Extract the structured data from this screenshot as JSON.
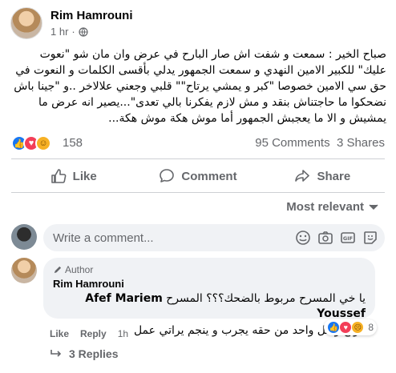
{
  "post": {
    "author": "Rim Hamrouni",
    "time": "1 hr",
    "text": "صباح الخير : سمعت و شفت اش صار البارح في عرض وان مان شو \"نعوت عليك\" للكبير الامين النهدي و سمعت الجمهور يدلي بأقسى الكلمات و النعوت في حق سي الامين خصوصا \"كبر و يمشي يرتاح\"\" قلبي وجعني علالاخر ..و \"جينا باش نضحكوا ما حاجتناش بنقد و مش لازم يفكرنا بالي تعدى\"...يصير انه عرض ما يمشيش و الا ما يعجبش الجمهور أما موش هكة موش هكة..."
  },
  "stats": {
    "reaction_count": "158",
    "comments": "95 Comments",
    "shares": "3 Shares"
  },
  "actions": {
    "like": "Like",
    "comment": "Comment",
    "share": "Share"
  },
  "sort": {
    "label": "Most relevant"
  },
  "composer": {
    "placeholder": "Write a comment..."
  },
  "comment": {
    "badge": "Author",
    "author": "Rim Hamrouni",
    "mention": "Afef Mariem Youssef",
    "text_line1": "يا خي المسرح مربوط بالضحك؟؟؟ المسرح",
    "text_line2": "أنواع و كل واحد من حقه يجرب و ينجم يراتي عمل",
    "reaction_count": "8",
    "like": "Like",
    "reply": "Reply",
    "time": "1h"
  },
  "replies": {
    "label": "3 Replies"
  },
  "colors": {
    "like_blue": "#1877f2",
    "love_red": "#f33e58",
    "care_yellow": "#f7b125",
    "secondary_text": "#65676b",
    "bubble_bg": "#f0f2f5"
  }
}
